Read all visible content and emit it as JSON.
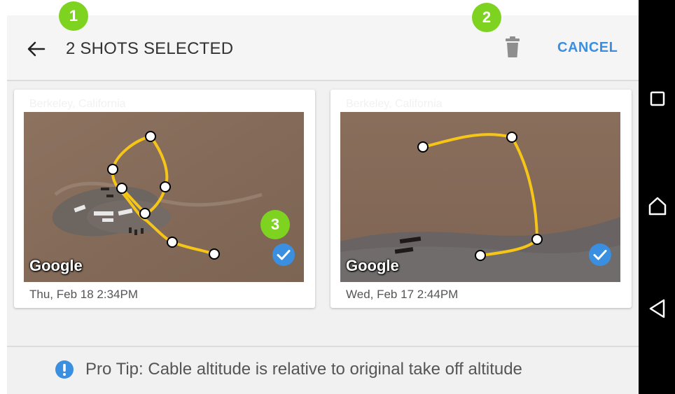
{
  "header": {
    "title": "2 SHOTS SELECTED",
    "cancel_label": "CANCEL",
    "back_icon": "arrow-left-icon",
    "delete_icon": "trash-icon"
  },
  "shots": [
    {
      "location": "Berkeley, California",
      "date": "Thu, Feb 18 2:34PM",
      "map_label": "Google",
      "selected": true
    },
    {
      "location": "Berkeley, California",
      "date": "Wed, Feb 17 2:44PM",
      "map_label": "Google",
      "selected": true
    }
  ],
  "pro_tip": "Pro Tip: Cable altitude is relative to original take off altitude",
  "annotations": [
    "1",
    "2",
    "3"
  ],
  "colors": {
    "accent": "#3b8fe0",
    "path": "#f5c518",
    "badge": "#7ed321",
    "terrain": "#8a6e5a"
  },
  "system_nav": [
    "recents-square-icon",
    "home-icon",
    "back-triangle-icon"
  ]
}
